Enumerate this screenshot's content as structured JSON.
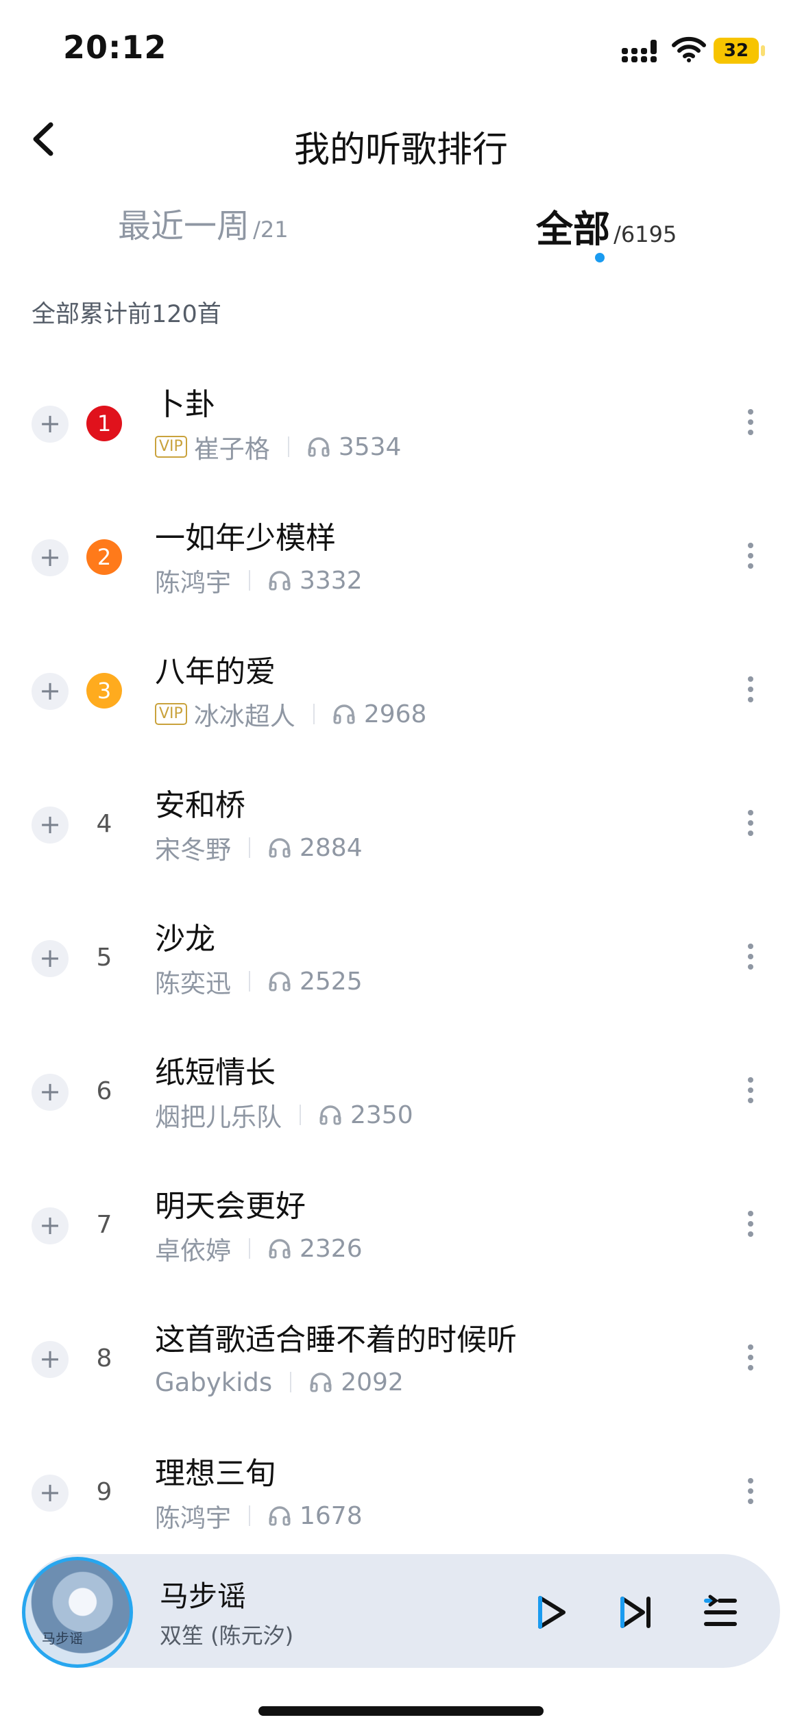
{
  "status_bar": {
    "time": "20:12",
    "battery": "32"
  },
  "header": {
    "title": "我的听歌排行"
  },
  "tabs": [
    {
      "label": "最近一周",
      "count": "/21",
      "active": false
    },
    {
      "label": "全部",
      "count": "/6195",
      "active": true
    }
  ],
  "summary": "全部累计前120首",
  "songs": [
    {
      "rank": "1",
      "title": "卜卦",
      "vip": "VIP",
      "artist": "崔子格",
      "plays": "3534",
      "medal_color": "#e0121c"
    },
    {
      "rank": "2",
      "title": "一如年少模样",
      "vip": "",
      "artist": "陈鸿宇",
      "plays": "3332",
      "medal_color": "#ff7a1a"
    },
    {
      "rank": "3",
      "title": "八年的爱",
      "vip": "VIP",
      "artist": "冰冰超人",
      "plays": "2968",
      "medal_color": "#ffab1e"
    },
    {
      "rank": "4",
      "title": "安和桥",
      "vip": "",
      "artist": "宋冬野",
      "plays": "2884"
    },
    {
      "rank": "5",
      "title": "沙龙",
      "vip": "",
      "artist": "陈奕迅",
      "plays": "2525"
    },
    {
      "rank": "6",
      "title": "纸短情长",
      "vip": "",
      "artist": "烟把儿乐队",
      "plays": "2350"
    },
    {
      "rank": "7",
      "title": "明天会更好",
      "vip": "",
      "artist": "卓依婷",
      "plays": "2326"
    },
    {
      "rank": "8",
      "title": "这首歌适合睡不着的时候听",
      "vip": "",
      "artist": "Gabykids",
      "plays": "2092"
    },
    {
      "rank": "9",
      "title": "理想三旬",
      "vip": "",
      "artist": "陈鸿宇",
      "plays": "1678"
    }
  ],
  "player": {
    "title": "马步谣",
    "artist": "双笙 (陈元汐)",
    "cover_text": "马步谣"
  },
  "icons": {
    "add": "plus-icon",
    "more": "more-vertical-icon",
    "plays": "headphone-icon",
    "back": "chevron-left-icon",
    "play": "play-icon",
    "next": "next-track-icon",
    "queue": "playlist-icon"
  },
  "colors": {
    "accent": "#1a9bf0",
    "vip": "#c9a23c",
    "player_ring": "#27a6ef"
  }
}
